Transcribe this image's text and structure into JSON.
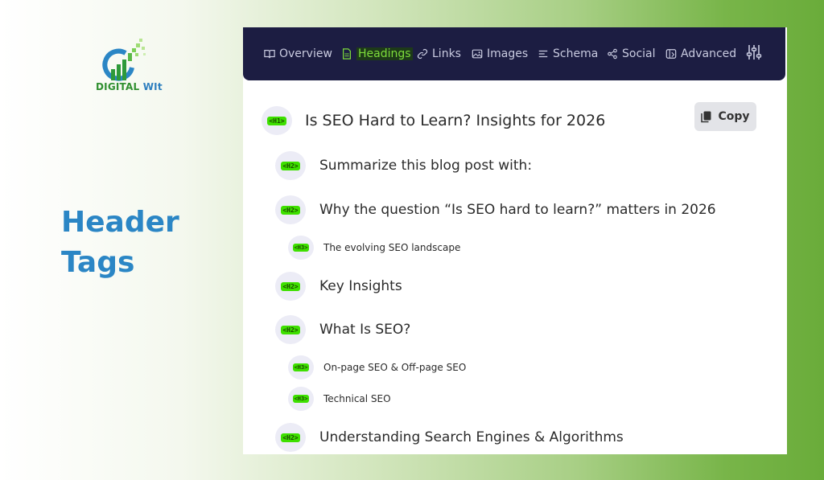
{
  "brand": {
    "name_part1": "DIGITAL ",
    "name_part2": "WIt"
  },
  "side_title": {
    "line1": "Header",
    "line2": "Tags"
  },
  "nav": {
    "overview": "Overview",
    "headings": "Headings",
    "links": "Links",
    "images": "Images",
    "schema": "Schema",
    "social": "Social",
    "advanced": "Advanced"
  },
  "copy_label": "Copy",
  "headings": [
    {
      "tag": "<H1>",
      "text": "Is SEO Hard to Learn? Insights for 2026"
    },
    {
      "tag": "<H2>",
      "text": "Summarize this blog post with:"
    },
    {
      "tag": "<H2>",
      "text": "Why the question “Is SEO hard to learn?” matters in 2026"
    },
    {
      "tag": "<H3>",
      "text": "The evolving SEO landscape"
    },
    {
      "tag": "<H2>",
      "text": "Key Insights"
    },
    {
      "tag": "<H2>",
      "text": "What Is SEO?"
    },
    {
      "tag": "<H3>",
      "text": "On-page SEO & Off-page SEO"
    },
    {
      "tag": "<H3>",
      "text": "Technical SEO"
    },
    {
      "tag": "<H2>",
      "text": "Understanding Search Engines & Algorithms"
    }
  ],
  "colors": {
    "nav_bg": "#1c1d42",
    "active": "#7ddc3b",
    "badge": "#3ee000",
    "title": "#2b86c5"
  }
}
